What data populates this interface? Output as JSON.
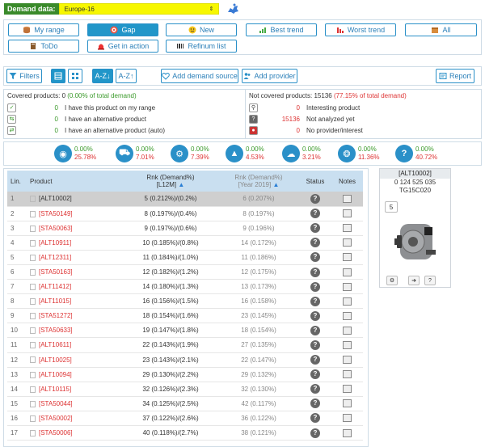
{
  "header": {
    "demand_label": "Demand data:",
    "demand_value": "Europe-16"
  },
  "tabs": [
    {
      "label": "My range",
      "icon": "database-icon"
    },
    {
      "label": "Gap",
      "icon": "target-icon"
    },
    {
      "label": "New",
      "icon": "smile-icon"
    },
    {
      "label": "Best trend",
      "icon": "chart-up-icon"
    },
    {
      "label": "Worst trend",
      "icon": "chart-down-icon"
    },
    {
      "label": "All",
      "icon": "box-icon"
    },
    {
      "label": "ToDo",
      "icon": "book-icon"
    },
    {
      "label": "Get in action",
      "icon": "alarm-icon"
    },
    {
      "label": "Refinum list",
      "icon": "barcode-icon"
    }
  ],
  "toolbar": {
    "filters": "Filters",
    "sort_desc": "A-Z↓",
    "sort_asc": "A-Z↑",
    "add_source": "Add demand source",
    "add_provider": "Add provider",
    "report": "Report"
  },
  "covered": {
    "title_prefix": "Covered products: 0 ",
    "title_pct": "(0.00% of total demand)",
    "rows": [
      {
        "icon": "check",
        "count": "0",
        "label": "I have this product on my range"
      },
      {
        "icon": "swap",
        "count": "0",
        "label": "I have an alternative product"
      },
      {
        "icon": "swap-auto",
        "count": "0",
        "label": "I have an alternative product (auto)"
      }
    ]
  },
  "not_covered": {
    "title_prefix": "Not covered products: 15136 ",
    "title_pct": "(77.15% of total demand)",
    "rows": [
      {
        "icon": "search",
        "count": "0",
        "label": "Interesting product"
      },
      {
        "icon": "question",
        "count": "15136",
        "label": "Not analyzed yet"
      },
      {
        "icon": "stop",
        "count": "0",
        "label": "No provider/interest"
      }
    ]
  },
  "stats": [
    {
      "a": "0.00%",
      "b": "25.78%"
    },
    {
      "a": "0.00%",
      "b": "7.01%"
    },
    {
      "a": "0.00%",
      "b": "7.39%"
    },
    {
      "a": "0.00%",
      "b": "4.53%"
    },
    {
      "a": "0.00%",
      "b": "3.21%"
    },
    {
      "a": "0.00%",
      "b": "11.36%"
    },
    {
      "a": "0.00%",
      "b": "40.72%"
    }
  ],
  "table": {
    "headers": {
      "lin": "Lin.",
      "product": "Product",
      "rnk1_a": "Rnk (Demand%)",
      "rnk1_b": "[L12M]",
      "rnk2_a": "Rnk (Demand%)",
      "rnk2_b": "[Year 2019]",
      "status": "Status",
      "notes": "Notes"
    },
    "rows": [
      {
        "lin": "1",
        "product": "[ALT10002]",
        "rnk1": "5 (0.212%)/(0.2%)",
        "rnk2": "6 (0.207%)"
      },
      {
        "lin": "2",
        "product": "[STA50149]",
        "rnk1": "8 (0.197%)/(0.4%)",
        "rnk2": "8 (0.197%)"
      },
      {
        "lin": "3",
        "product": "[STA50063]",
        "rnk1": "9 (0.197%)/(0.6%)",
        "rnk2": "9 (0.196%)"
      },
      {
        "lin": "4",
        "product": "[ALT10911]",
        "rnk1": "10 (0.185%)/(0.8%)",
        "rnk2": "14 (0.172%)"
      },
      {
        "lin": "5",
        "product": "[ALT12311]",
        "rnk1": "11 (0.184%)/(1.0%)",
        "rnk2": "11 (0.186%)"
      },
      {
        "lin": "6",
        "product": "[STA50163]",
        "rnk1": "12 (0.182%)/(1.2%)",
        "rnk2": "12 (0.175%)"
      },
      {
        "lin": "7",
        "product": "[ALT11412]",
        "rnk1": "14 (0.180%)/(1.3%)",
        "rnk2": "13 (0.173%)"
      },
      {
        "lin": "8",
        "product": "[ALT11015]",
        "rnk1": "16 (0.156%)/(1.5%)",
        "rnk2": "16 (0.158%)"
      },
      {
        "lin": "9",
        "product": "[STA51272]",
        "rnk1": "18 (0.154%)/(1.6%)",
        "rnk2": "23 (0.145%)"
      },
      {
        "lin": "10",
        "product": "[STA50633]",
        "rnk1": "19 (0.147%)/(1.8%)",
        "rnk2": "18 (0.154%)"
      },
      {
        "lin": "11",
        "product": "[ALT10611]",
        "rnk1": "22 (0.143%)/(1.9%)",
        "rnk2": "27 (0.135%)"
      },
      {
        "lin": "12",
        "product": "[ALT10025]",
        "rnk1": "23 (0.143%)/(2.1%)",
        "rnk2": "22 (0.147%)"
      },
      {
        "lin": "13",
        "product": "[ALT10094]",
        "rnk1": "29 (0.130%)/(2.2%)",
        "rnk2": "29 (0.132%)"
      },
      {
        "lin": "14",
        "product": "[ALT10115]",
        "rnk1": "32 (0.126%)/(2.3%)",
        "rnk2": "32 (0.130%)"
      },
      {
        "lin": "15",
        "product": "[STA50044]",
        "rnk1": "34 (0.125%)/(2.5%)",
        "rnk2": "42 (0.117%)"
      },
      {
        "lin": "16",
        "product": "[STA50002]",
        "rnk1": "37 (0.122%)/(2.6%)",
        "rnk2": "36 (0.122%)"
      },
      {
        "lin": "17",
        "product": "[STA50006]",
        "rnk1": "40 (0.118%)/(2.7%)",
        "rnk2": "38 (0.121%)"
      }
    ]
  },
  "side": {
    "title": "[ALT10002]",
    "line1": "0 124 525 035",
    "line2": "TG15C020",
    "qty": "5"
  }
}
